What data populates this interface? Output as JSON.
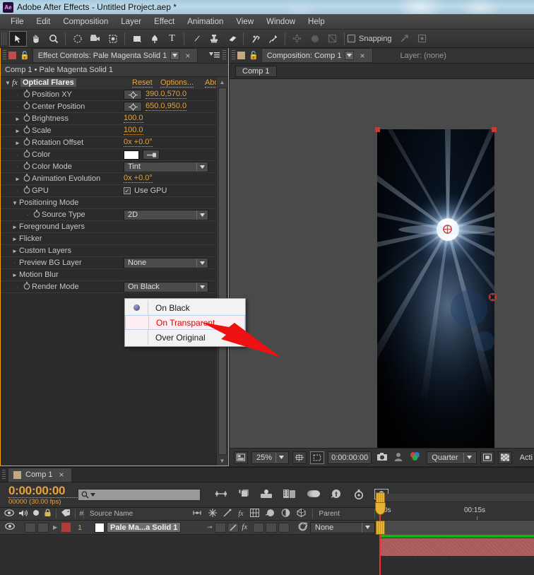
{
  "window": {
    "title": "Adobe After Effects - Untitled Project.aep *",
    "logo": "ae-logo"
  },
  "menubar": {
    "items": [
      "File",
      "Edit",
      "Composition",
      "Layer",
      "Effect",
      "Animation",
      "View",
      "Window",
      "Help"
    ]
  },
  "toolbar": {
    "tools": [
      {
        "name": "selection-tool",
        "glyph": "➤",
        "selected": true
      },
      {
        "name": "hand-tool",
        "glyph": "✋",
        "selected": false
      },
      {
        "name": "zoom-tool",
        "glyph": "🔍",
        "selected": false
      },
      {
        "name": "rotation-tool",
        "glyph": "↺",
        "selected": false
      },
      {
        "name": "camera-tool",
        "glyph": "🎥",
        "selected": false
      },
      {
        "name": "pan-behind-tool",
        "glyph": "❉",
        "selected": false
      },
      {
        "name": "shape-tool",
        "glyph": "■",
        "selected": false
      },
      {
        "name": "pen-tool",
        "glyph": "✒",
        "selected": false
      },
      {
        "name": "text-tool",
        "glyph": "T",
        "selected": false
      },
      {
        "name": "brush-tool",
        "glyph": "╱",
        "selected": false
      },
      {
        "name": "clone-stamp-tool",
        "glyph": "⚒",
        "selected": false
      },
      {
        "name": "eraser-tool",
        "glyph": "▱",
        "selected": false
      },
      {
        "name": "roto-brush-tool",
        "glyph": "⚘",
        "selected": false
      },
      {
        "name": "puppet-pin-tool",
        "glyph": "📌",
        "selected": false
      }
    ],
    "dim_tools": [
      {
        "name": "move-axis-icon",
        "glyph": "✥"
      },
      {
        "name": "orbit-icon",
        "glyph": "●"
      },
      {
        "name": "track-icon",
        "glyph": "◫"
      }
    ],
    "snapping_label": "Snapping",
    "snapping_checked": false,
    "snap_extra": [
      {
        "name": "snap-align-icon",
        "glyph": "↗"
      },
      {
        "name": "snap-target-icon",
        "glyph": "⬚"
      }
    ]
  },
  "effect_controls": {
    "tab_title": "Effect Controls: Pale Magenta Solid 1",
    "breadcrumb": "Comp 1 • Pale Magenta Solid 1",
    "effect_title": "Optical Flares",
    "reset_label": "Reset",
    "options_label": "Options...",
    "about_label": "Abo",
    "rows": [
      {
        "name": "position-xy",
        "label": "Position XY",
        "indent": 1,
        "marker": "dot",
        "stopwatch": true,
        "control": "position",
        "value": "390.0,570.0"
      },
      {
        "name": "center-position",
        "label": "Center Position",
        "indent": 1,
        "marker": "dot",
        "stopwatch": true,
        "control": "position",
        "value": "650.0,950.0"
      },
      {
        "name": "brightness",
        "label": "Brightness",
        "indent": 1,
        "marker": "tri-right",
        "stopwatch": true,
        "control": "value",
        "value": "100.0"
      },
      {
        "name": "scale",
        "label": "Scale",
        "indent": 1,
        "marker": "tri-right",
        "stopwatch": true,
        "control": "value",
        "value": "100.0"
      },
      {
        "name": "rotation-offset",
        "label": "Rotation Offset",
        "indent": 1,
        "marker": "tri-right",
        "stopwatch": true,
        "control": "value",
        "value": "0x +0.0°"
      },
      {
        "name": "color",
        "label": "Color",
        "indent": 1,
        "marker": "dot",
        "stopwatch": true,
        "control": "color",
        "value": "#ffffff"
      },
      {
        "name": "color-mode",
        "label": "Color Mode",
        "indent": 1,
        "marker": "dot",
        "stopwatch": true,
        "control": "dropdown",
        "value": "Tint"
      },
      {
        "name": "animation-evolution",
        "label": "Animation Evolution",
        "indent": 1,
        "marker": "tri-right",
        "stopwatch": true,
        "control": "value",
        "value": "0x +0.0°"
      },
      {
        "name": "gpu",
        "label": "GPU",
        "indent": 1,
        "marker": "dot",
        "stopwatch": true,
        "control": "checkbox",
        "value": "Use GPU"
      },
      {
        "name": "positioning-mode",
        "label": "Positioning Mode",
        "indent": 0,
        "marker": "tri-down",
        "stopwatch": false,
        "control": "none",
        "value": ""
      },
      {
        "name": "source-type",
        "label": "Source Type",
        "indent": 2,
        "marker": "dot",
        "stopwatch": true,
        "control": "dropdown",
        "value": "2D"
      },
      {
        "name": "foreground-layers",
        "label": "Foreground Layers",
        "indent": 0,
        "marker": "tri-right",
        "stopwatch": false,
        "control": "none",
        "value": ""
      },
      {
        "name": "flicker",
        "label": "Flicker",
        "indent": 0,
        "marker": "tri-right",
        "stopwatch": false,
        "control": "none",
        "value": ""
      },
      {
        "name": "custom-layers",
        "label": "Custom Layers",
        "indent": 0,
        "marker": "tri-right",
        "stopwatch": false,
        "control": "none",
        "value": ""
      },
      {
        "name": "preview-bg-layer",
        "label": "Preview BG Layer",
        "indent": 0,
        "marker": "dot",
        "stopwatch": false,
        "control": "dropdown",
        "value": "None"
      },
      {
        "name": "motion-blur",
        "label": "Motion Blur",
        "indent": 0,
        "marker": "tri-right",
        "stopwatch": false,
        "control": "none",
        "value": ""
      },
      {
        "name": "render-mode",
        "label": "Render Mode",
        "indent": 1,
        "marker": "dot",
        "stopwatch": true,
        "control": "dropdown",
        "value": "On Black"
      }
    ]
  },
  "render_mode_menu": {
    "items": [
      {
        "label": "On Black",
        "selected": true,
        "highlighted": false
      },
      {
        "label": "On Transparent",
        "selected": false,
        "highlighted": true
      },
      {
        "label": "Over Original",
        "selected": false,
        "highlighted": false
      }
    ]
  },
  "composition_panel": {
    "tab_title": "Composition: Comp 1",
    "layer_tab_title": "Layer: (none)",
    "sub_tab": "Comp 1",
    "bottombar": {
      "zoom": "25%",
      "timecode": "0:00:00:00",
      "resolution": "Quarter",
      "active_label": "Acti",
      "icons": [
        {
          "name": "toggle-region-icon",
          "glyph": "▣"
        },
        {
          "name": "roi-icon",
          "glyph": "⬚"
        },
        {
          "name": "mask-icon",
          "glyph": "⬜"
        },
        {
          "name": "snapshot-icon",
          "glyph": "📷"
        },
        {
          "name": "show-snapshot-icon",
          "glyph": "👤"
        },
        {
          "name": "channel-icon",
          "glyph": "◉"
        },
        {
          "name": "transparency-grid-icon",
          "glyph": "▦"
        }
      ]
    }
  },
  "timeline": {
    "tab_title": "Comp 1",
    "current_time": "0:00:00:00",
    "frame_info": "00000 (30.00 fps)",
    "search_placeholder": "",
    "columns": {
      "source_name": "Source Name",
      "parent": "Parent",
      "hash": "#"
    },
    "switch_icons": [
      {
        "name": "eye-icon",
        "glyph": "👁"
      },
      {
        "name": "audio-icon",
        "glyph": "🔊"
      },
      {
        "name": "solo-icon",
        "glyph": "●"
      },
      {
        "name": "lock-icon",
        "glyph": "🔒"
      },
      {
        "name": "label-icon",
        "glyph": "🏷"
      }
    ],
    "mode_icons": [
      {
        "name": "shy-icon",
        "glyph": "⊸"
      },
      {
        "name": "effects-icon",
        "glyph": "✸"
      },
      {
        "name": "quality-icon",
        "glyph": "╱"
      },
      {
        "name": "fx-icon",
        "glyph": "fx"
      },
      {
        "name": "frame-blend-icon",
        "glyph": "▦"
      },
      {
        "name": "motion-blur-icon",
        "glyph": "◐"
      },
      {
        "name": "adjustment-icon",
        "glyph": "◑"
      },
      {
        "name": "3d-layer-icon",
        "glyph": "⬡"
      }
    ],
    "toolbar_icons": [
      {
        "name": "motion-blur-toggle-icon",
        "glyph": "⊸"
      },
      {
        "name": "3d-renderer-icon",
        "glyph": "▧"
      },
      {
        "name": "brainstorm-icon",
        "glyph": "⚙"
      },
      {
        "name": "film-icon",
        "glyph": "▥"
      },
      {
        "name": "frame-blending-icon",
        "glyph": "◕"
      },
      {
        "name": "motion-blur-icon",
        "glyph": "◉"
      },
      {
        "name": "auto-keyframe-icon",
        "glyph": "⏱"
      },
      {
        "name": "graph-editor-icon",
        "glyph": "↗"
      }
    ],
    "layers": [
      {
        "index": "1",
        "name": "Pale Ma...a Solid 1",
        "label_color": "#b53b3b",
        "swatch": "#ffffff",
        "parent": "None",
        "visible": true
      }
    ],
    "ruler": {
      "start_label": "0s",
      "mid_label": "00:15s"
    }
  },
  "colors": {
    "accent_orange": "#e8a33d",
    "panel_focus": "#f0a500",
    "highlight_red": "#e00000",
    "layer_red": "#b53b3b",
    "work_area_green": "#17b117"
  }
}
